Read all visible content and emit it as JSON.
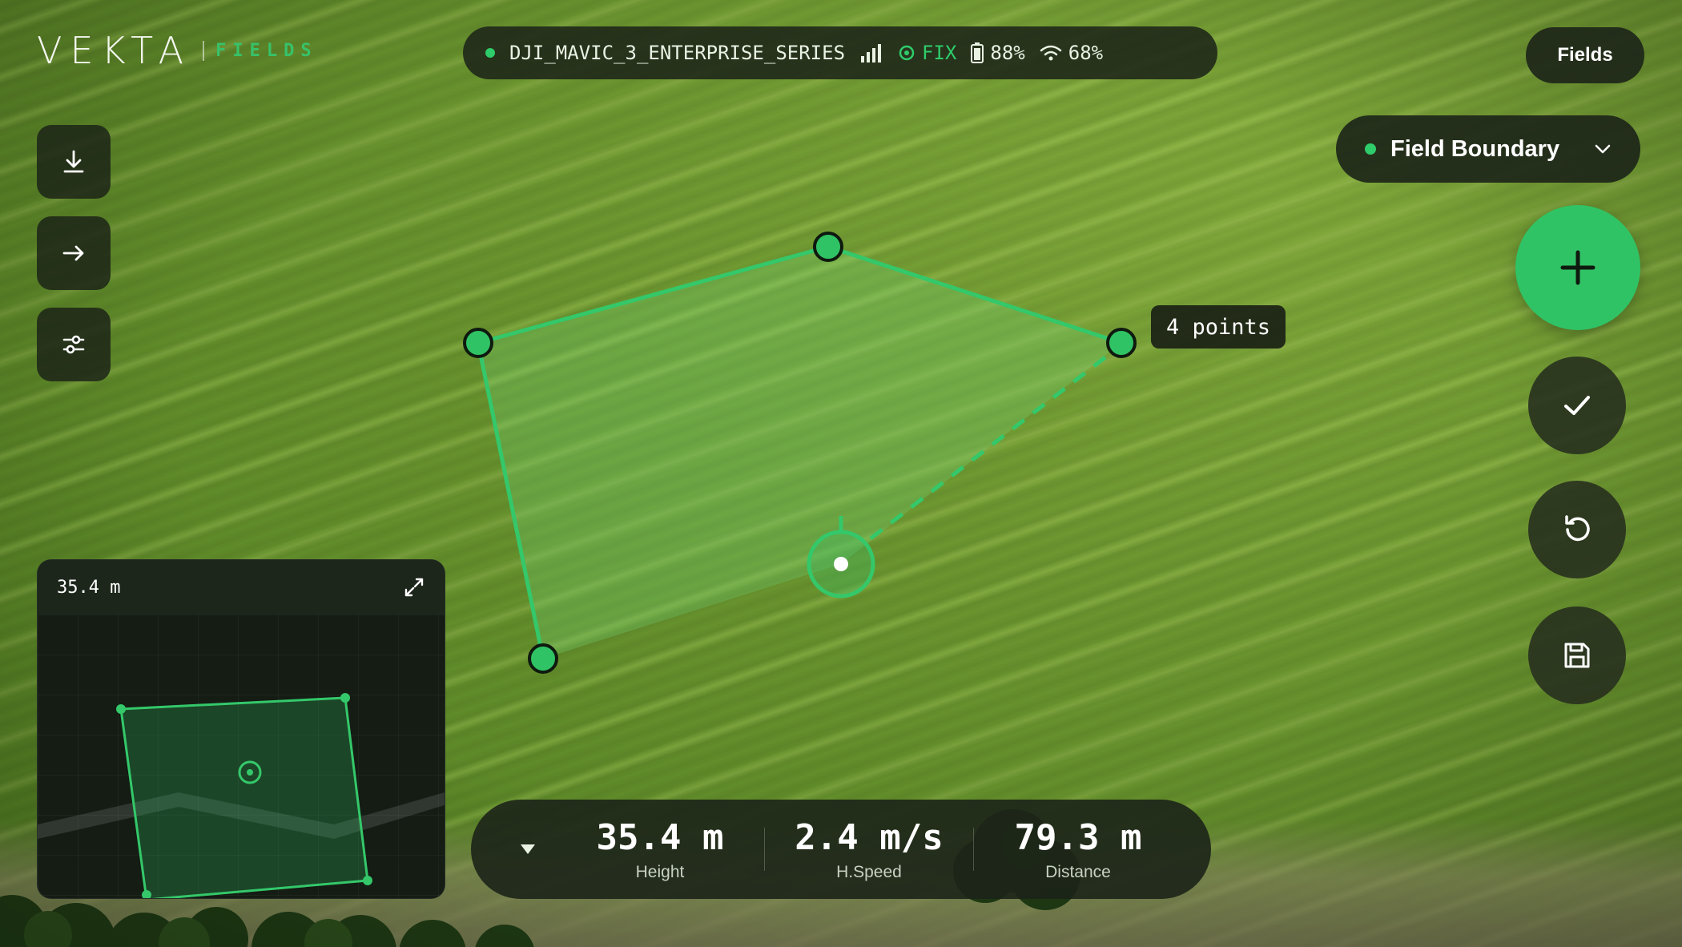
{
  "brand": {
    "name": "VEKTA",
    "product": "FIELDS"
  },
  "status": {
    "device": "DJI_MAVIC_3_ENTERPRISE_SERIES",
    "gps": "FIX",
    "battery": "88%",
    "wifi": "68%",
    "signal_icon": "signal-bars-icon"
  },
  "header": {
    "fields_label": "Fields"
  },
  "layer": {
    "label": "Field Boundary"
  },
  "map": {
    "points_label": "4 points"
  },
  "minimap": {
    "altitude": "35.4 m"
  },
  "telemetry": [
    {
      "value": "35.4 m",
      "label": "Height"
    },
    {
      "value": "2.4 m/s",
      "label": "H.Speed"
    },
    {
      "value": "79.3 m",
      "label": "Distance"
    }
  ],
  "colors": {
    "accent": "#30c365",
    "panel": "#1c2418",
    "field": "#6b952f"
  }
}
